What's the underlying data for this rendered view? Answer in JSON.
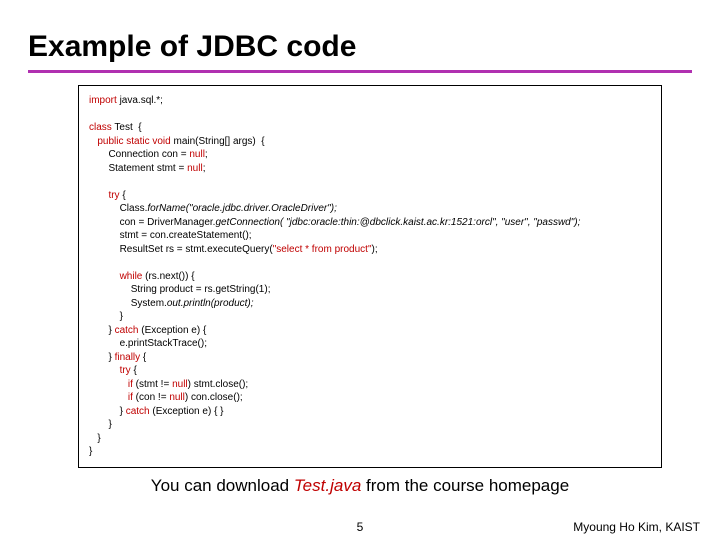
{
  "title": "Example of JDBC code",
  "code": {
    "l1a": "import",
    "l1b": " java.sql.*;",
    "l2a": "class",
    "l2b": " Test  {",
    "l3a": "public static void",
    "l3b": " main(String[] args)  {",
    "l4a": "Connection con = ",
    "l4b": "null",
    "l4c": ";",
    "l5a": "Statement stmt = ",
    "l5b": "null",
    "l5c": ";",
    "l6a": "try",
    "l6b": " {",
    "l7a": "Class.",
    "l7b": "forName(\"oracle.jdbc.driver.OracleDriver\");",
    "l8a": "con = DriverManager.",
    "l8b": "getConnection( \"jdbc:oracle:thin:@dbclick.kaist.ac.kr:1521:orcl\", \"user\", \"passwd\");",
    "l9": "stmt = con.createStatement();",
    "l10a": "ResultSet rs = stmt.executeQuery(",
    "l10b": "\"select * from product\"",
    "l10c": ");",
    "l11a": "while",
    "l11b": " (rs.next()) {",
    "l12": "String product = rs.getString(1);",
    "l13a": "System.",
    "l13b": "out.println(product);",
    "l14": "}",
    "l15a": "} ",
    "l15b": "catch",
    "l15c": " (Exception e) {",
    "l16": "e.printStackTrace();",
    "l17a": "} ",
    "l17b": "finally",
    "l17c": " {",
    "l18a": "try",
    "l18b": " {",
    "l19a": "if",
    "l19b": " (stmt != ",
    "l19c": "null",
    "l19d": ") stmt.close();",
    "l20a": "if",
    "l20b": " (con != ",
    "l20c": "null",
    "l20d": ") con.close();",
    "l21a": "} ",
    "l21b": "catch",
    "l21c": " (Exception e) { }",
    "l22": "}",
    "l23": "}",
    "l24": "}"
  },
  "caption_pre": "You can download ",
  "caption_em": "Test.java",
  "caption_post": " from the course homepage",
  "pagenum": "5",
  "author": "Myoung Ho Kim, KAIST"
}
